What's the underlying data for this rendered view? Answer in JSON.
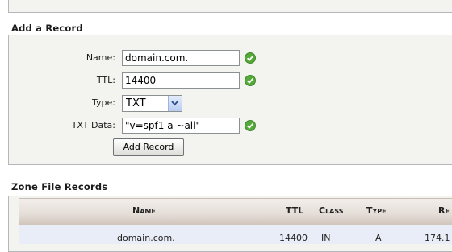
{
  "add_record": {
    "heading": "Add a Record",
    "name": {
      "label": "Name:",
      "value": "domain.com."
    },
    "ttl": {
      "label": "TTL:",
      "value": "14400"
    },
    "type": {
      "label": "Type:",
      "value": "TXT"
    },
    "txt_data": {
      "label": "TXT Data:",
      "value": "\"v=spf1 a ~all\""
    },
    "submit_label": "Add Record"
  },
  "zone_records": {
    "heading": "Zone File Records",
    "columns": [
      "Name",
      "TTL",
      "Class",
      "Type",
      "Re"
    ],
    "rows": [
      [
        "domain.com.",
        "14400",
        "IN",
        "A",
        "174.1"
      ]
    ]
  },
  "colors": {
    "valid_check": "#55a83a",
    "panel_bg": "#f3f4f0",
    "header_bg": "#e6dfd9"
  },
  "icons": {
    "valid": "check-circle-icon",
    "dropdown": "chevron-down-icon"
  }
}
